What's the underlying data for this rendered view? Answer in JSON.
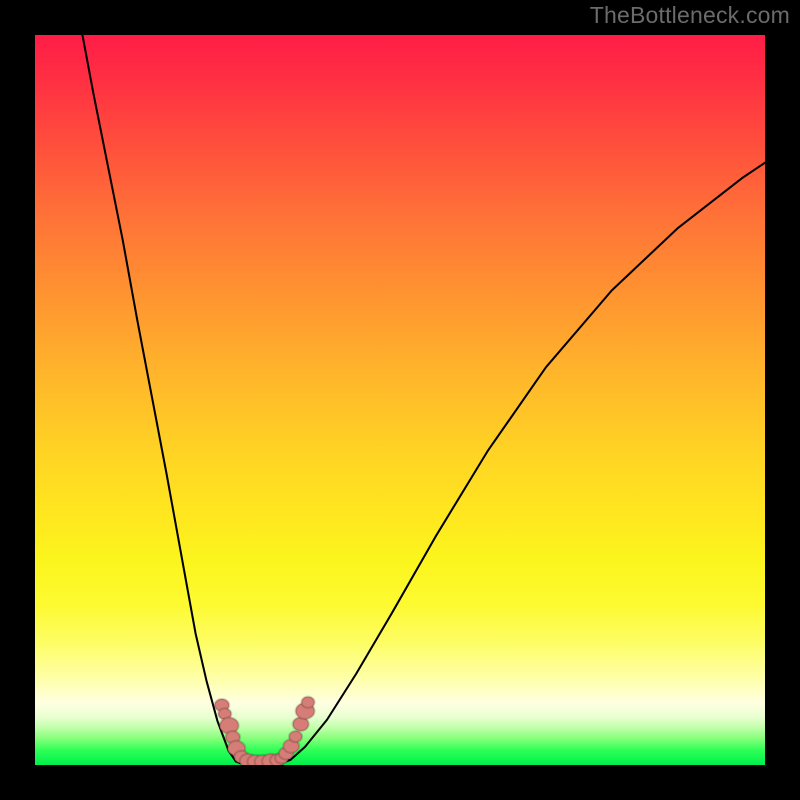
{
  "watermark": "TheBottleneck.com",
  "colors": {
    "page_bg": "#000000",
    "watermark": "#6b6b6b",
    "curve": "#000000",
    "marker": "#d57d76"
  },
  "chart_data": {
    "type": "line",
    "title": "",
    "xlabel": "",
    "ylabel": "",
    "xlim": [
      0,
      100
    ],
    "ylim": [
      0,
      100
    ],
    "grid": false,
    "legend": false,
    "annotations": [],
    "series": [
      {
        "name": "left-branch",
        "x": [
          6.5,
          8,
          10,
          12,
          14,
          16,
          18,
          20,
          22,
          23.5,
          25,
          26.5,
          27.5
        ],
        "y": [
          100,
          92,
          82,
          72,
          61,
          50.5,
          40,
          29,
          18,
          11.5,
          6,
          2,
          0.5
        ]
      },
      {
        "name": "valley-floor",
        "x": [
          27.5,
          28.5,
          30,
          32,
          33.5,
          35
        ],
        "y": [
          0.5,
          0.1,
          0.05,
          0.05,
          0.2,
          0.7
        ]
      },
      {
        "name": "right-branch",
        "x": [
          35,
          37,
          40,
          44,
          49,
          55,
          62,
          70,
          79,
          88,
          97,
          100
        ],
        "y": [
          0.7,
          2.5,
          6.2,
          12.5,
          21,
          31.5,
          43,
          54.5,
          65,
          73.5,
          80.5,
          82.5
        ]
      }
    ],
    "markers": {
      "name": "highlight-dots",
      "points": [
        {
          "x": 25.6,
          "y": 8.2,
          "r": 1.0
        },
        {
          "x": 26.0,
          "y": 7.0,
          "r": 0.9
        },
        {
          "x": 26.6,
          "y": 5.4,
          "r": 1.3
        },
        {
          "x": 27.1,
          "y": 3.8,
          "r": 1.0
        },
        {
          "x": 27.6,
          "y": 2.3,
          "r": 1.2
        },
        {
          "x": 28.3,
          "y": 1.1,
          "r": 1.0
        },
        {
          "x": 29.2,
          "y": 0.55,
          "r": 1.15
        },
        {
          "x": 30.2,
          "y": 0.45,
          "r": 1.1
        },
        {
          "x": 31.2,
          "y": 0.45,
          "r": 1.1
        },
        {
          "x": 32.3,
          "y": 0.5,
          "r": 1.2
        },
        {
          "x": 33.2,
          "y": 0.65,
          "r": 1.0
        },
        {
          "x": 33.8,
          "y": 0.95,
          "r": 0.9
        },
        {
          "x": 34.4,
          "y": 1.6,
          "r": 1.0
        },
        {
          "x": 35.1,
          "y": 2.6,
          "r": 1.1
        },
        {
          "x": 35.7,
          "y": 3.9,
          "r": 0.9
        },
        {
          "x": 36.4,
          "y": 5.6,
          "r": 1.1
        },
        {
          "x": 37.0,
          "y": 7.4,
          "r": 1.3
        },
        {
          "x": 37.4,
          "y": 8.6,
          "r": 0.9
        }
      ]
    }
  }
}
